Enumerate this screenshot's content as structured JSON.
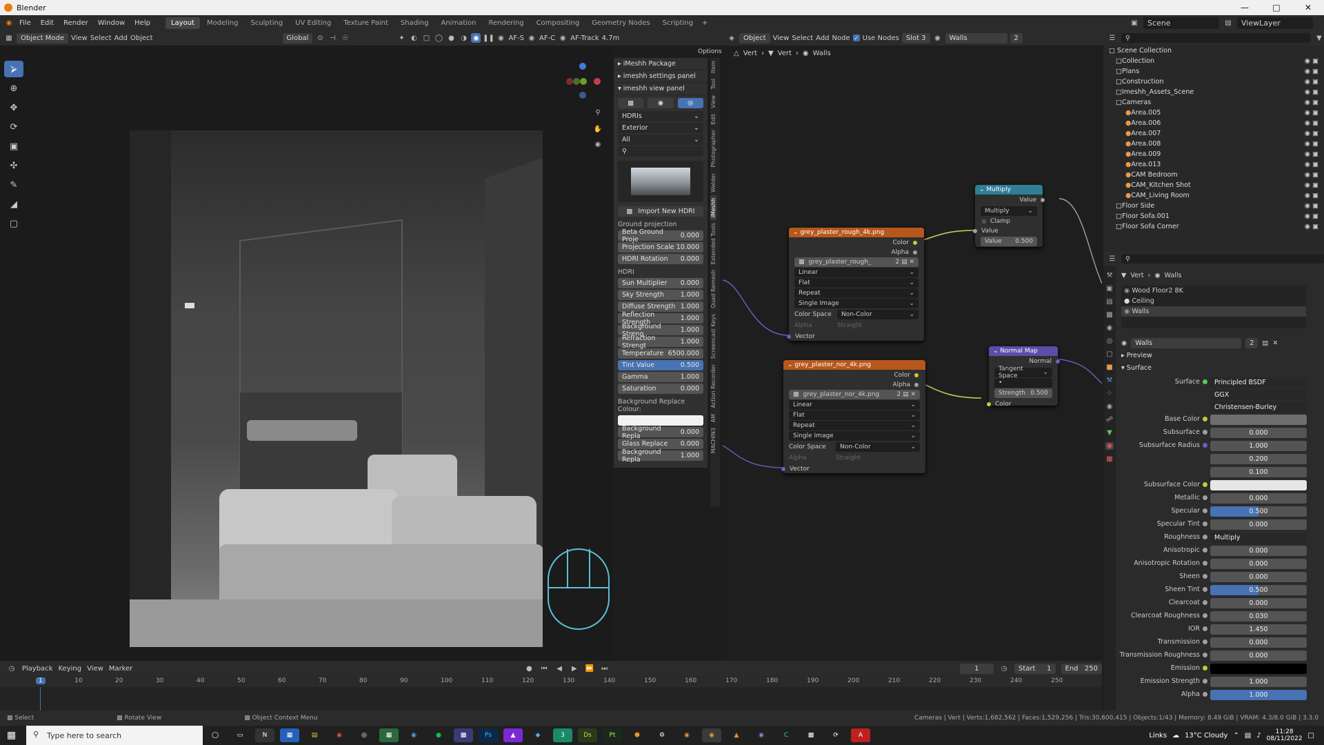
{
  "window": {
    "title": "Blender"
  },
  "menu": {
    "items": [
      "File",
      "Edit",
      "Render",
      "Window",
      "Help"
    ],
    "workspaces": [
      "Layout",
      "Modeling",
      "Sculpting",
      "UV Editing",
      "Texture Paint",
      "Shading",
      "Animation",
      "Rendering",
      "Compositing",
      "Geometry Nodes",
      "Scripting"
    ],
    "scene_label": "Scene",
    "viewlayer_label": "ViewLayer"
  },
  "viewport_header": {
    "mode": "Object Mode",
    "menus": [
      "View",
      "Select",
      "Add",
      "Object"
    ],
    "transform": "Global",
    "af_s": "AF-S",
    "af_c": "AF-C",
    "af_track": "AF-Track",
    "focal": "4.7m",
    "options": "Options"
  },
  "npanel": {
    "sections": [
      "iMeshh Package",
      "imeshh settings panel",
      "imeshh view panel"
    ],
    "dd1": "HDRIs",
    "dd2": "Exterior",
    "dd3": "All",
    "import_btn": "Import New HDRI",
    "ground_label": "Ground projection",
    "ground": [
      {
        "k": "Beta Ground Proje",
        "v": "0.000"
      },
      {
        "k": "Projection Scale",
        "v": "10.000"
      },
      {
        "k": "HDRI Rotation",
        "v": "0.000"
      }
    ],
    "hdri_label": "HDRI",
    "hdri": [
      {
        "k": "Sun Multiplier",
        "v": "0.000"
      },
      {
        "k": "Sky Strength",
        "v": "1.000"
      },
      {
        "k": "Diffuse Strength",
        "v": "1.000"
      },
      {
        "k": "Reflection Strength",
        "v": "1.000"
      },
      {
        "k": "Background Streng",
        "v": "1.000"
      },
      {
        "k": "Refraction Strengt",
        "v": "1.000"
      },
      {
        "k": "Temperature",
        "v": "6500.000"
      },
      {
        "k": "Tint Value",
        "v": "0.500"
      },
      {
        "k": "Gamma",
        "v": "1.000"
      },
      {
        "k": "Saturation",
        "v": "0.000"
      }
    ],
    "bg_label": "Background Replace Colour:",
    "bg": [
      {
        "k": "Background Repla",
        "v": "0.000"
      },
      {
        "k": "Glass Replace",
        "v": "0.000"
      },
      {
        "k": "Background Repla",
        "v": "1.000"
      }
    ],
    "tabs": [
      "Item",
      "Tool",
      "View",
      "Edit",
      "Photographer",
      "Welder",
      "iMeshh",
      "Extended Tools",
      "Quad Remesh",
      "Screencast Keys",
      "Action Recorder",
      "AM",
      "MACHIN3"
    ]
  },
  "node_header": {
    "mode": "Object",
    "menus": [
      "View",
      "Select",
      "Add",
      "Node"
    ],
    "use_nodes": "Use Nodes",
    "slot": "Slot 3",
    "material": "Walls",
    "users": "2",
    "breadcrumb": [
      "Vert",
      "Vert",
      "Walls"
    ]
  },
  "nodes": {
    "rough": {
      "title": "grey_plaster_rough_4k.png",
      "color": "Color",
      "alpha": "Alpha",
      "img": "grey_plaster_rough_",
      "users": "2",
      "interp": "Linear",
      "proj": "Flat",
      "ext": "Repeat",
      "src": "Single Image",
      "cs_label": "Color Space",
      "cs": "Non-Color",
      "al_label": "Alpha",
      "al": "Straight",
      "vector": "Vector"
    },
    "nor": {
      "title": "grey_plaster_nor_4k.png",
      "color": "Color",
      "alpha": "Alpha",
      "img": "grey_plaster_nor_4k.png",
      "users": "2",
      "interp": "Linear",
      "proj": "Flat",
      "ext": "Repeat",
      "src": "Single Image",
      "cs_label": "Color Space",
      "cs": "Non-Color",
      "al_label": "Alpha",
      "al": "Straight",
      "vector": "Vector"
    },
    "multiply": {
      "title": "Multiply",
      "value_out": "Value",
      "op": "Multiply",
      "clamp": "Clamp",
      "value_in": "Value",
      "value_field": "Value",
      "value_num": "0.500"
    },
    "normalmap": {
      "title": "Normal Map",
      "normal": "Normal",
      "space": "Tangent Space",
      "strength": "Strength",
      "strength_val": "0.500",
      "color": "Color"
    }
  },
  "outliner": {
    "root": "Scene Collection",
    "items": [
      {
        "n": "Collection",
        "d": 1
      },
      {
        "n": "Plans",
        "d": 1
      },
      {
        "n": "Construction",
        "d": 1
      },
      {
        "n": "Imeshh_Assets_Scene",
        "d": 1
      },
      {
        "n": "Cameras",
        "d": 1
      },
      {
        "n": "Area.005",
        "d": 2
      },
      {
        "n": "Area.006",
        "d": 2
      },
      {
        "n": "Area.007",
        "d": 2
      },
      {
        "n": "Area.008",
        "d": 2
      },
      {
        "n": "Area.009",
        "d": 2
      },
      {
        "n": "Area.013",
        "d": 2
      },
      {
        "n": "CAM Bedroom",
        "d": 2
      },
      {
        "n": "CAM_Kitchen Shot",
        "d": 2
      },
      {
        "n": "CAM_Living Room",
        "d": 2
      },
      {
        "n": "Floor Side",
        "d": 1
      },
      {
        "n": "Floor Sofa.001",
        "d": 1
      },
      {
        "n": "Floor Sofa Corner",
        "d": 1
      }
    ]
  },
  "props": {
    "breadcrumb": [
      "Vert",
      "Walls"
    ],
    "slots": [
      "Wood Floor2 8K",
      "Ceiling",
      "Walls"
    ],
    "material": "Walls",
    "users": "2",
    "preview": "Preview",
    "surface_sec": "Surface",
    "surface_label": "Surface",
    "surface_val": "Principled BSDF",
    "dist": "GGX",
    "sss_method": "Christensen-Burley",
    "rows": [
      {
        "k": "Base Color",
        "v": "",
        "t": "color",
        "c": "#6e6e6e",
        "s": "#c8c83c"
      },
      {
        "k": "Subsurface",
        "v": "0.000",
        "s": "#a0a0a0"
      },
      {
        "k": "Subsurface Radius",
        "v": "1.000",
        "s": "#6363c7"
      },
      {
        "k": "",
        "v": "0.200"
      },
      {
        "k": "",
        "v": "0.100"
      },
      {
        "k": "Subsurface Color",
        "v": "",
        "t": "color",
        "c": "#e6e6e6",
        "s": "#c8c83c"
      },
      {
        "k": "Metallic",
        "v": "0.000",
        "s": "#a0a0a0"
      },
      {
        "k": "Specular",
        "v": "0.500",
        "t": "blue",
        "s": "#a0a0a0"
      },
      {
        "k": "Specular Tint",
        "v": "0.000",
        "s": "#a0a0a0"
      },
      {
        "k": "Roughness",
        "v": "Multiply",
        "t": "link",
        "s": "#a0a0a0"
      },
      {
        "k": "Anisotropic",
        "v": "0.000",
        "s": "#a0a0a0"
      },
      {
        "k": "Anisotropic Rotation",
        "v": "0.000",
        "s": "#a0a0a0"
      },
      {
        "k": "Sheen",
        "v": "0.000",
        "s": "#a0a0a0"
      },
      {
        "k": "Sheen Tint",
        "v": "0.500",
        "t": "blue",
        "s": "#a0a0a0"
      },
      {
        "k": "Clearcoat",
        "v": "0.000",
        "s": "#a0a0a0"
      },
      {
        "k": "Clearcoat Roughness",
        "v": "0.030",
        "s": "#a0a0a0"
      },
      {
        "k": "IOR",
        "v": "1.450",
        "s": "#a0a0a0"
      },
      {
        "k": "Transmission",
        "v": "0.000",
        "s": "#a0a0a0"
      },
      {
        "k": "Transmission Roughness",
        "v": "0.000",
        "s": "#a0a0a0"
      },
      {
        "k": "Emission",
        "v": "",
        "t": "color",
        "c": "#000000",
        "s": "#c8c83c"
      },
      {
        "k": "Emission Strength",
        "v": "1.000",
        "s": "#a0a0a0"
      },
      {
        "k": "Alpha",
        "v": "1.000",
        "t": "full",
        "s": "#a0a0a0"
      }
    ]
  },
  "timeline": {
    "menus": [
      "Playback",
      "Keying",
      "View",
      "Marker"
    ],
    "current": "1",
    "start_label": "Start",
    "start": "1",
    "end_label": "End",
    "end": "250",
    "ticks": [
      "10",
      "20",
      "30",
      "40",
      "50",
      "60",
      "70",
      "80",
      "90",
      "100",
      "110",
      "120",
      "130",
      "140",
      "150",
      "160",
      "170",
      "180",
      "190",
      "200",
      "210",
      "220",
      "230",
      "240",
      "250"
    ],
    "marker": "1"
  },
  "status": {
    "select": "Select",
    "rotate": "Rotate View",
    "context": "Object Context Menu",
    "stats": "Cameras | Vert | Verts:1,682,562 | Faces:1,529,256 | Tris:30,600,415 | Objects:1/43 | Memory: 8.49 GiB | VRAM: 4.3/8.0 GiB | 3.3.0"
  },
  "taskbar": {
    "search": "Type here to search",
    "links": "Links",
    "weather": "13°C  Cloudy",
    "time": "11:28",
    "date": "08/11/2022"
  },
  "colors": {
    "accent": "#4772b3",
    "node_orange": "#b8571c",
    "node_teal": "#2f7e96",
    "node_purple": "#5f4ca8"
  }
}
